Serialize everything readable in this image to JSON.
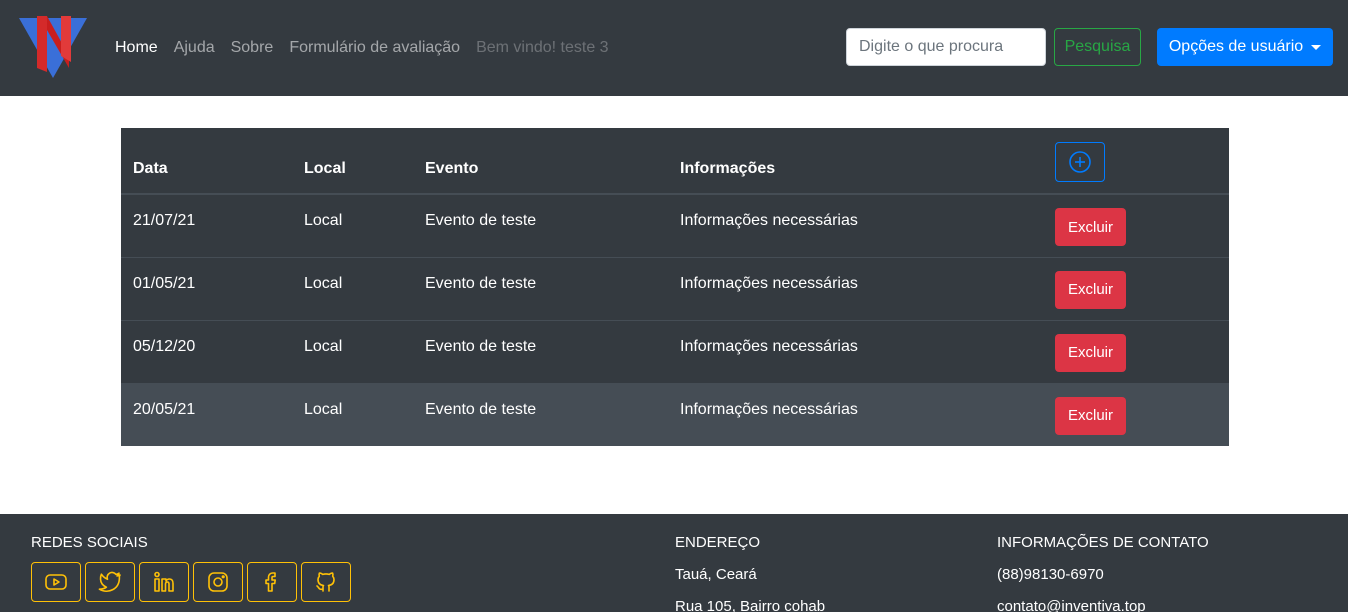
{
  "nav": {
    "items": [
      {
        "label": "Home"
      },
      {
        "label": "Ajuda"
      },
      {
        "label": "Sobre"
      },
      {
        "label": "Formulário de avaliação"
      }
    ],
    "welcome": "Bem vindo! teste 3",
    "search_placeholder": "Digite o que procura",
    "search_button": "Pesquisa",
    "user_menu": "Opções de usuário"
  },
  "table": {
    "headers": [
      "Data",
      "Local",
      "Evento",
      "Informações"
    ],
    "delete_label": "Excluir",
    "rows": [
      {
        "data": "21/07/21",
        "local": "Local",
        "evento": "Evento de teste",
        "info": "Informações necessárias"
      },
      {
        "data": "01/05/21",
        "local": "Local",
        "evento": "Evento de teste",
        "info": "Informações necessárias"
      },
      {
        "data": "05/12/20",
        "local": "Local",
        "evento": "Evento de teste",
        "info": "Informações necessárias"
      },
      {
        "data": "20/05/21",
        "local": "Local",
        "evento": "Evento de teste",
        "info": "Informações necessárias"
      }
    ]
  },
  "footer": {
    "social_title": "REDES SOCIAIS",
    "social_icons": [
      "youtube-icon",
      "twitter-icon",
      "linkedin-icon",
      "instagram-icon",
      "facebook-icon",
      "github-icon"
    ],
    "address_title": "ENDEREÇO",
    "address_line1": "Tauá, Ceará",
    "address_line2": "Rua 105, Bairro cohab",
    "contact_title": "INFORMAÇÕES DE CONTATO",
    "phone": "(88)98130-6970",
    "email": "contato@inventiva.top"
  },
  "colors": {
    "navbar_bg": "#343a40",
    "primary": "#007bff",
    "success": "#28a745",
    "danger": "#dc3545",
    "warning": "#ffc107"
  }
}
